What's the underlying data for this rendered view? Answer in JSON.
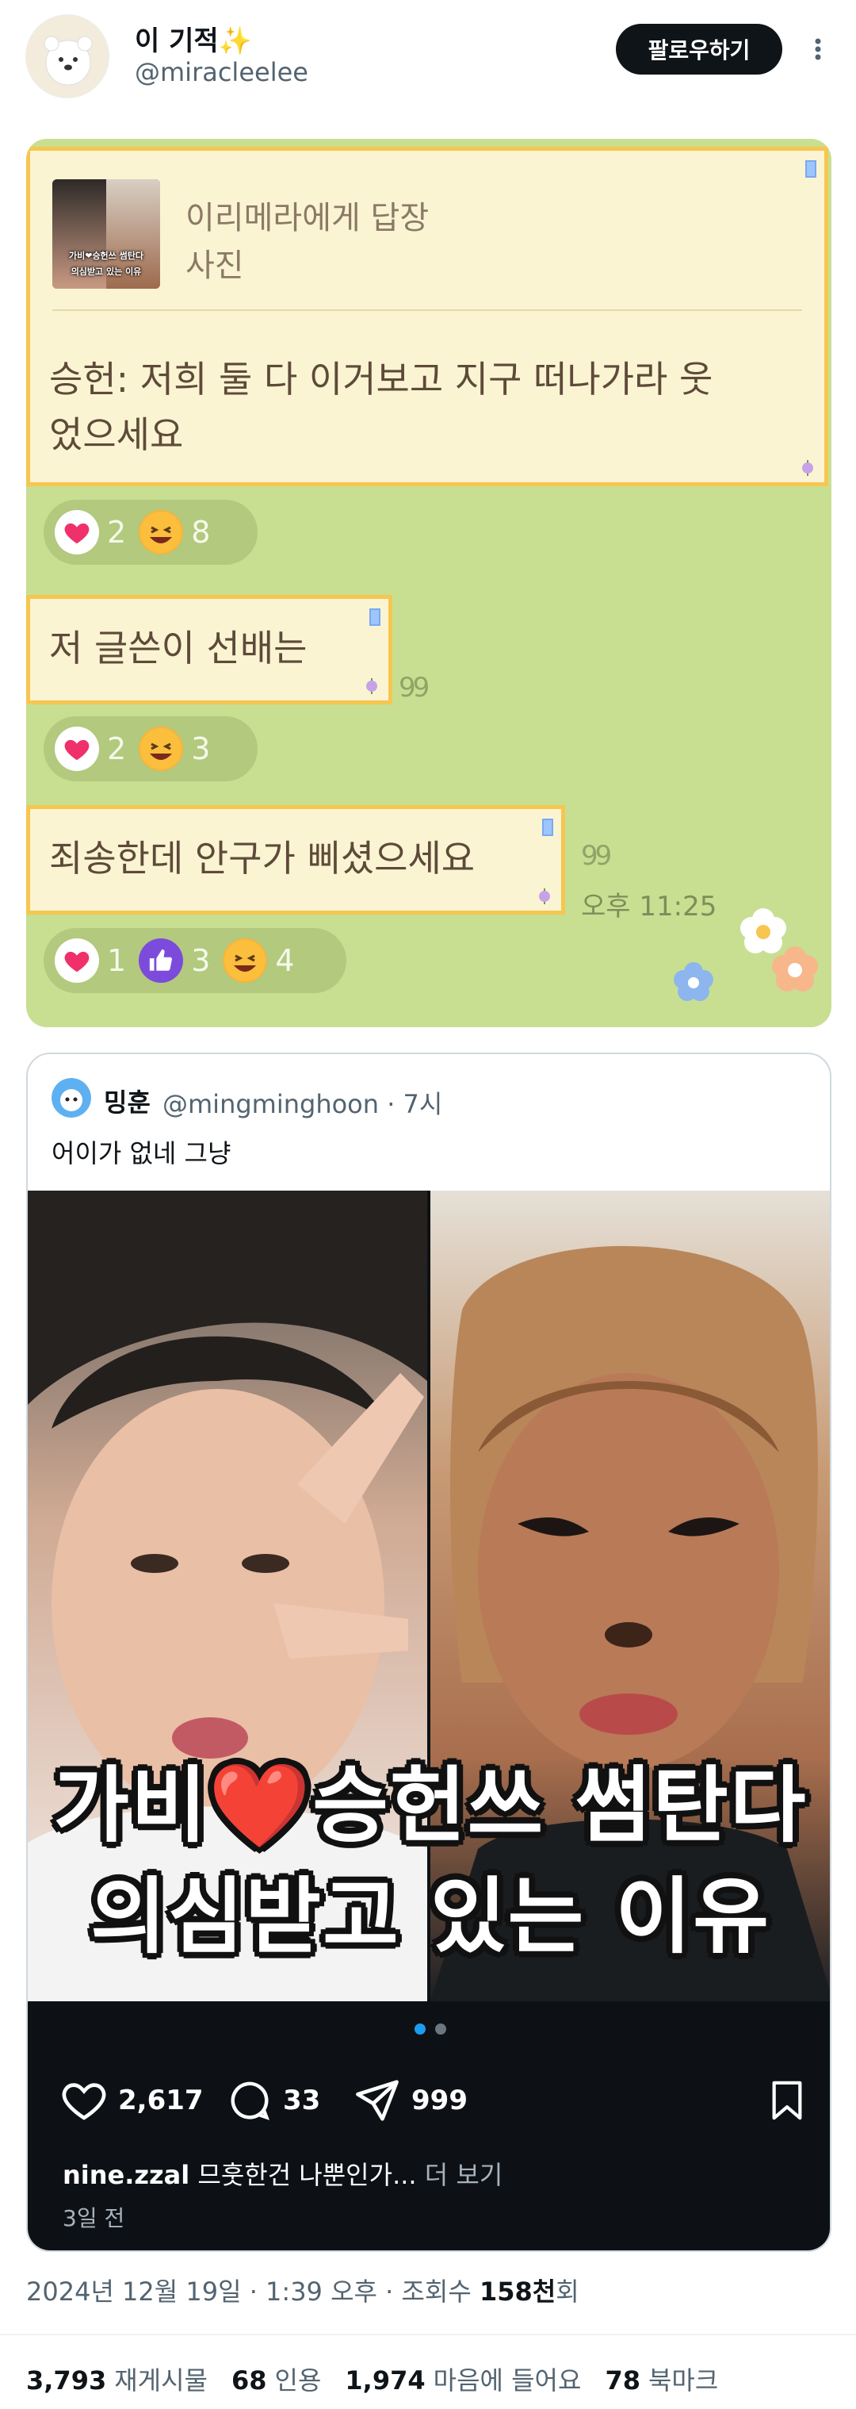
{
  "author": {
    "display_name": "이 기적✨",
    "handle": "@miracleelee",
    "follow_label": "팔로우하기"
  },
  "chat": {
    "reply": {
      "to_label": "이리메라에게 답장",
      "type_label": "사진",
      "thumb_caption_1": "가비❤승헌쓰 썸탄다",
      "thumb_caption_2": "의심받고 있는 이유",
      "text_line1": "승헌: 저희 둘 다 이거보고 지구 떠나가라 웃",
      "text_line2": "었으세요"
    },
    "msg2": "저 글쓴이 선배는",
    "msg3": "죄송한데 안구가 삐셨으세요",
    "read_mark": "99",
    "time": "오후 11:25",
    "reactions1": {
      "heart": "2",
      "laugh": "8"
    },
    "reactions2": {
      "heart": "2",
      "laugh": "3"
    },
    "reactions3": {
      "heart": "1",
      "like": "3",
      "laugh": "4"
    },
    "colors": {
      "background": "#c8df92",
      "bubble": "#fbf4d3",
      "bubble_border": "#f6c650"
    }
  },
  "quoted": {
    "name": "밍훈",
    "handle": "@mingminghoon · 7시",
    "text": "어이가 없네 그냥",
    "caption_line1": "가비❤️승헌쓰 썸탄다",
    "caption_line2": "의심받고 있는 이유",
    "likes": "2,617",
    "comments": "33",
    "shares": "999",
    "ig_user": "nine.zzal",
    "ig_caption": "므훗한건 나뿐인가...",
    "ig_more": "더 보기",
    "ig_time": "3일 전"
  },
  "post_meta": {
    "datetime": "2024년 12월 19일 · 1:39 오후 · 조회수 ",
    "views": "158천",
    "views_suffix": "회"
  },
  "stats": {
    "reposts_n": "3,793",
    "reposts_l": "재게시물",
    "quotes_n": "68",
    "quotes_l": "인용",
    "likes_n": "1,974",
    "likes_l": "마음에 들어요",
    "bookmarks_n": "78",
    "bookmarks_l": "북마크"
  }
}
